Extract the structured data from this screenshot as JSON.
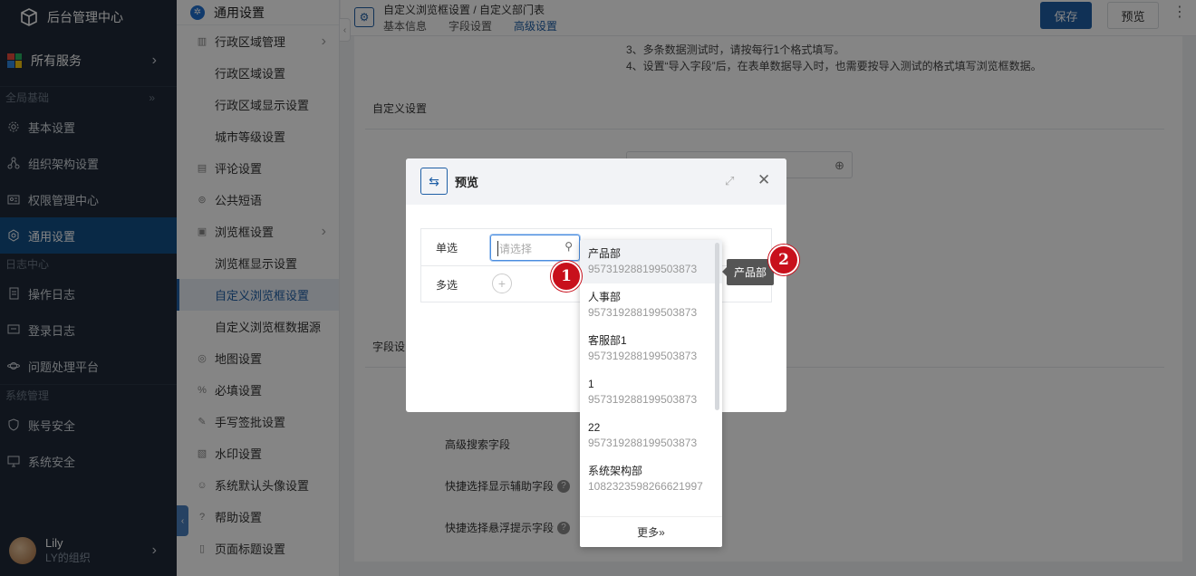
{
  "app": {
    "title": "后台管理中心"
  },
  "sidebar": {
    "all_services": "所有服务",
    "sections": [
      {
        "title": "全局基础",
        "items": [
          "基本设置",
          "组织架构设置",
          "权限管理中心",
          "通用设置"
        ]
      },
      {
        "title": "日志中心",
        "items": [
          "操作日志",
          "登录日志",
          "问题处理平台"
        ]
      },
      {
        "title": "系统管理",
        "items": [
          "账号安全",
          "系统安全"
        ]
      }
    ],
    "active_item": "通用设置",
    "user": {
      "name": "Lily",
      "org": "LY的组织"
    }
  },
  "subnav": {
    "title": "通用设置",
    "items": [
      {
        "label": "行政区域管理",
        "level": 1,
        "arrow": true
      },
      {
        "label": "行政区域设置",
        "level": 2
      },
      {
        "label": "行政区域显示设置",
        "level": 2
      },
      {
        "label": "城市等级设置",
        "level": 2
      },
      {
        "label": "评论设置",
        "level": 1
      },
      {
        "label": "公共短语",
        "level": 1
      },
      {
        "label": "浏览框设置",
        "level": 1,
        "arrow": true
      },
      {
        "label": "浏览框显示设置",
        "level": 2
      },
      {
        "label": "自定义浏览框设置",
        "level": 2,
        "active": true
      },
      {
        "label": "自定义浏览框数据源",
        "level": 2
      },
      {
        "label": "地图设置",
        "level": 1
      },
      {
        "label": "必填设置",
        "level": 1
      },
      {
        "label": "手写签批设置",
        "level": 1
      },
      {
        "label": "水印设置",
        "level": 1
      },
      {
        "label": "系统默认头像设置",
        "level": 1
      },
      {
        "label": "帮助设置",
        "level": 1
      },
      {
        "label": "页面标题设置",
        "level": 1
      }
    ]
  },
  "header": {
    "breadcrumb": "自定义浏览框设置  /  自定义部门表",
    "tabs": [
      "基本信息",
      "字段设置",
      "高级设置"
    ],
    "active_tab": "高级设置",
    "save_label": "保存",
    "preview_label": "预览"
  },
  "content": {
    "note3": "3、多条数据测试时，请按每行1个格式填写。",
    "note4": "4、设置“导入字段”后，在表单数据导入时，也需要按导入测试的格式填写浏览框数据。",
    "section_custom": "自定义设置",
    "section_field": "字段设",
    "field_labels": [
      "高级搜索字段",
      "快捷选择显示辅助字段",
      "快捷选择悬浮提示字段"
    ]
  },
  "modal": {
    "title": "预览",
    "single_label": "单选",
    "multi_label": "多选",
    "placeholder": "请选择"
  },
  "dropdown": {
    "items": [
      {
        "name": "产品部",
        "code": "957319288199503873"
      },
      {
        "name": "人事部",
        "code": "957319288199503873"
      },
      {
        "name": "客服部1",
        "code": "957319288199503873"
      },
      {
        "name": "1",
        "code": "957319288199503873"
      },
      {
        "name": "22",
        "code": "957319288199503873"
      },
      {
        "name": "系统架构部",
        "code": "1082323598266621997"
      }
    ],
    "more_label": "更多»"
  },
  "tooltip": "产品部",
  "markers": [
    "1",
    "2"
  ],
  "colors": {
    "sidebar_bg": "#1f2a38",
    "accent": "#1f5fa6",
    "marker": "#c8101c"
  }
}
